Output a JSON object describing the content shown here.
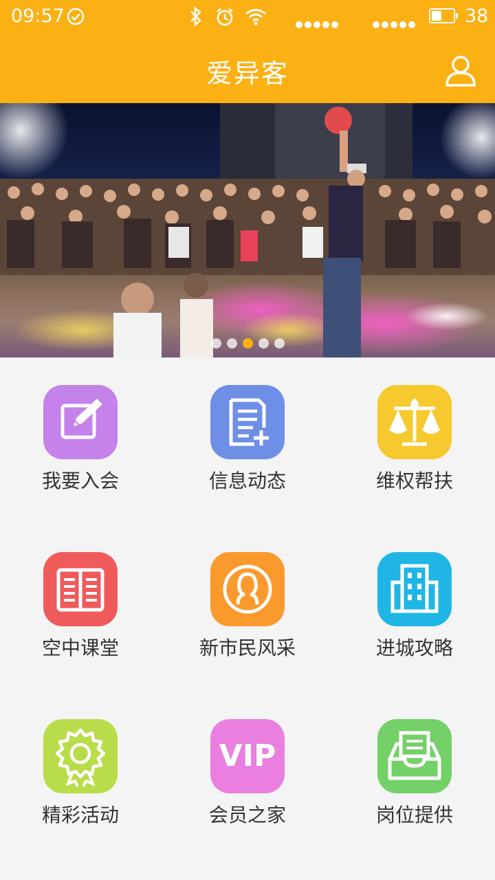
{
  "status_bar": {
    "time": "09:57",
    "battery": "38"
  },
  "header": {
    "title": "爱异客"
  },
  "banner": {
    "page_count": 5,
    "active_page": 3
  },
  "menu": [
    {
      "label": "我要入会",
      "color": "#c482ea",
      "icon": "edit-icon"
    },
    {
      "label": "信息动态",
      "color": "#6f8fe6",
      "icon": "document-add-icon"
    },
    {
      "label": "维权帮扶",
      "color": "#f6c92e",
      "icon": "scales-icon"
    },
    {
      "label": "空中课堂",
      "color": "#ef5b5b",
      "icon": "book-icon"
    },
    {
      "label": "新市民风采",
      "color": "#fb9a2c",
      "icon": "person-icon"
    },
    {
      "label": "进城攻略",
      "color": "#1fb6e6",
      "icon": "building-icon"
    },
    {
      "label": "精彩活动",
      "color": "#b9dc4a",
      "icon": "award-icon"
    },
    {
      "label": "会员之家",
      "color": "#ea7fe0",
      "icon": "vip-icon",
      "icon_text": "VIP"
    },
    {
      "label": "岗位提供",
      "color": "#74d068",
      "icon": "inbox-icon"
    }
  ]
}
